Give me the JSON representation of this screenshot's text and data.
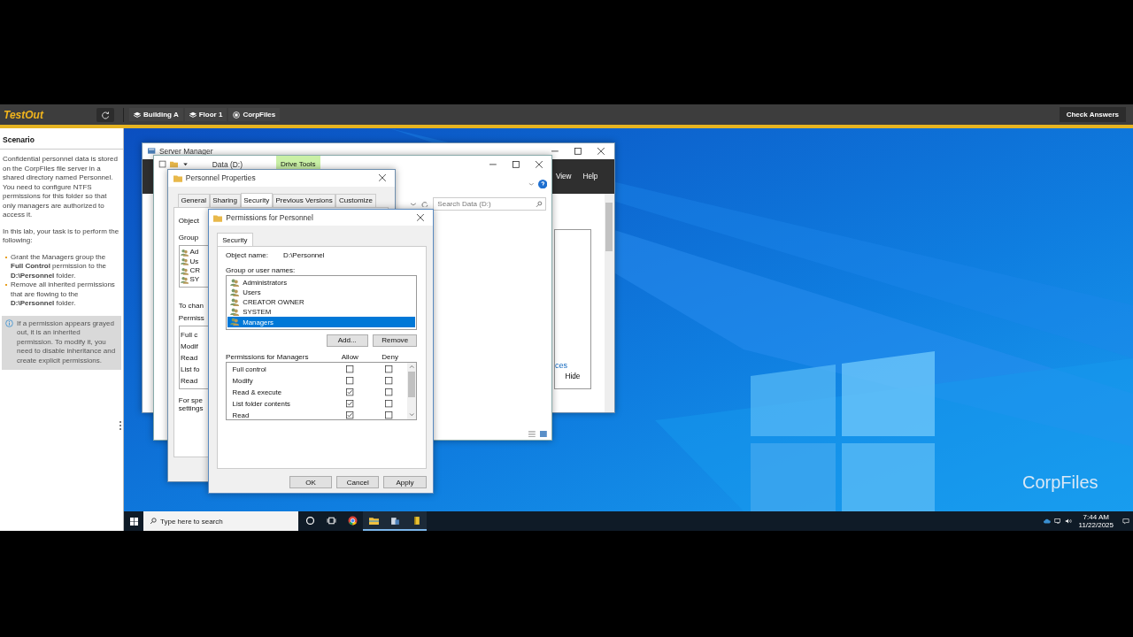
{
  "top_bar": {
    "logo": "TestOut",
    "breadcrumbs": [
      {
        "label": "Building A",
        "kind": "layers"
      },
      {
        "label": "Floor 1",
        "kind": "layers"
      },
      {
        "label": "CorpFiles",
        "kind": "server"
      }
    ],
    "check_button": "Check Answers"
  },
  "scenario": {
    "title": "Scenario",
    "paragraphs": [
      "Confidential personnel data is stored on the CorpFiles file server in a shared directory named Personnel. You need to configure NTFS permissions for this folder so that only managers are authorized to access it.",
      "In this lab, your task is to perform the following:"
    ],
    "tasks": [
      "Grant the Managers group the **Full Control** permission to the **D:\\Personnel** folder.",
      "Remove all inherited permissions that are flowing to the **D:\\Personnel** folder."
    ],
    "note": "If a permission appears grayed out, it is an inherited permission. To modify it, you need to disable inheritance and create explicit permissions."
  },
  "desktop": {
    "label": "CorpFiles",
    "server_manager": {
      "title": "Server Manager",
      "menu": [
        "View",
        "Help"
      ],
      "link_fragment": "ces",
      "hide_button": "Hide"
    },
    "explorer": {
      "title": "Data (D:)",
      "ribbon_tab": "Drive Tools",
      "search": {
        "placeholder": "Search Data (D:)"
      }
    },
    "properties": {
      "title": "Personnel Properties",
      "tabs": [
        {
          "label": "General",
          "selected": false
        },
        {
          "label": "Sharing",
          "selected": false
        },
        {
          "label": "Security",
          "selected": true
        },
        {
          "label": "Previous Versions",
          "selected": false
        },
        {
          "label": "Customize",
          "selected": false
        }
      ],
      "object_label": "Object",
      "group_label": "Group",
      "group_items": [
        "Ad",
        "Us",
        "CR",
        "SY"
      ],
      "change_note": "To chan",
      "permissions_label": "Permiss",
      "permission_items": [
        "Full c",
        "Modif",
        "Read",
        "List fo",
        "Read"
      ],
      "special_note": [
        "For spe",
        "settings"
      ]
    },
    "permissions": {
      "title": "Permissions for Personnel",
      "tab": "Security",
      "object_name_label": "Object name:",
      "object_name": "D:\\Personnel",
      "groups_label": "Group or user names:",
      "groups": [
        {
          "name": "Administrators",
          "selected": false
        },
        {
          "name": "Users",
          "selected": false
        },
        {
          "name": "CREATOR OWNER",
          "selected": false
        },
        {
          "name": "SYSTEM",
          "selected": false
        },
        {
          "name": "Managers",
          "selected": true
        }
      ],
      "add_button": "Add...",
      "remove_button": "Remove",
      "permissions_label": "Permissions for Managers",
      "allow_label": "Allow",
      "deny_label": "Deny",
      "rows": [
        {
          "name": "Full control",
          "allow": false,
          "deny": false
        },
        {
          "name": "Modify",
          "allow": false,
          "deny": false
        },
        {
          "name": "Read & execute",
          "allow": true,
          "deny": false
        },
        {
          "name": "List folder contents",
          "allow": true,
          "deny": false
        },
        {
          "name": "Read",
          "allow": true,
          "deny": false
        }
      ],
      "buttons": [
        "OK",
        "Cancel",
        "Apply"
      ]
    }
  },
  "taskbar": {
    "search": {
      "placeholder": "Type here to search"
    },
    "apps": [
      {
        "kind": "cortana",
        "running": false
      },
      {
        "kind": "task-view",
        "running": false
      },
      {
        "kind": "chrome",
        "running": false
      },
      {
        "kind": "file-explorer",
        "running": true
      },
      {
        "kind": "server-manager",
        "running": true
      },
      {
        "kind": "notebook",
        "running": true
      }
    ],
    "time": "7:44 AM",
    "date": "11/22/2025"
  }
}
